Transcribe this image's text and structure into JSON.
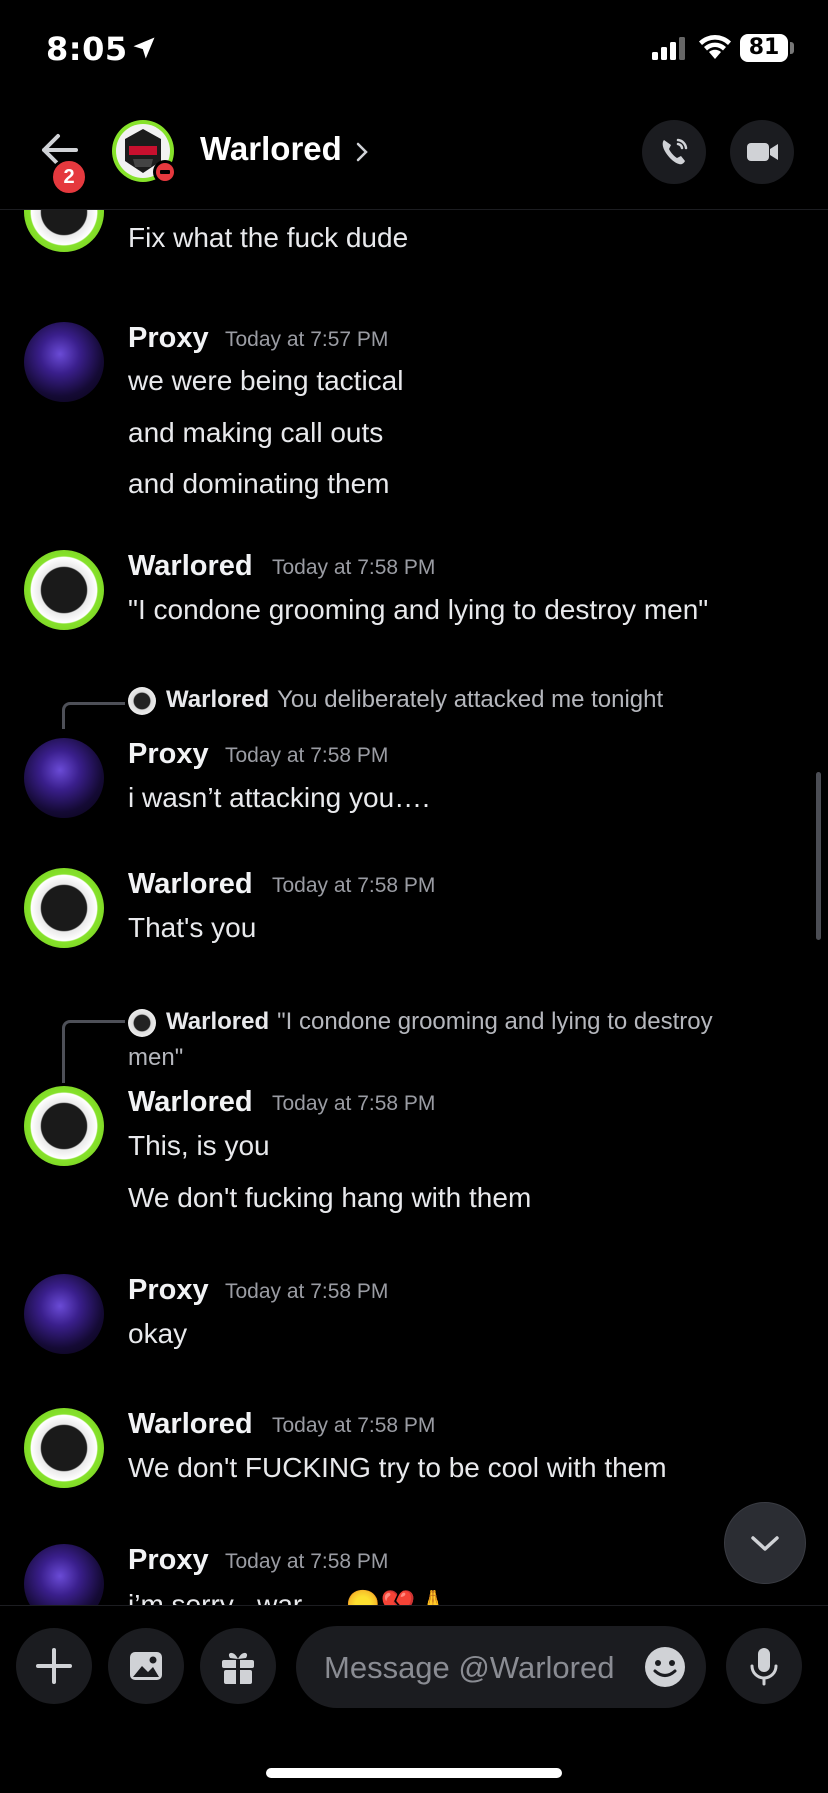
{
  "status_bar": {
    "time": "8:05",
    "battery": "81"
  },
  "header": {
    "back_badge": "2",
    "title": "Warlored",
    "chevron": "›"
  },
  "messages": [
    {
      "line": "Fix what the fuck dude"
    },
    {
      "author": "Proxy",
      "timestamp": "Today at 7:57 PM",
      "lines": [
        "we were being tactical",
        "and making call outs",
        "and dominating them"
      ]
    },
    {
      "author": "Warlored",
      "timestamp": "Today at 7:58 PM",
      "lines": [
        "\"I condone grooming and lying to destroy men\""
      ]
    },
    {
      "reply_to": {
        "author": "Warlored",
        "text": "You deliberately attacked me tonight"
      },
      "author": "Proxy",
      "timestamp": "Today at 7:58 PM",
      "lines": [
        "i wasn’t attacking you…."
      ]
    },
    {
      "author": "Warlored",
      "timestamp": "Today at 7:58 PM",
      "lines": [
        "That's you"
      ]
    },
    {
      "reply_to": {
        "author": "Warlored",
        "text": "\"I condone grooming and lying to destroy",
        "text2": "men\""
      },
      "author": "Warlored",
      "timestamp": "Today at 7:58 PM",
      "lines": [
        "This, is you",
        "We don't fucking hang with them"
      ]
    },
    {
      "author": "Proxy",
      "timestamp": "Today at 7:58 PM",
      "lines": [
        "okay"
      ]
    },
    {
      "author": "Warlored",
      "timestamp": "Today at 7:58 PM",
      "lines": [
        "We don't FUCKING try to be cool with them"
      ]
    },
    {
      "author": "Proxy",
      "timestamp": "Today at 7:58 PM",
      "lines": [
        "i’m sorry , war … 😞💔🙏"
      ]
    }
  ],
  "composer": {
    "placeholder": "Message @Warlored"
  },
  "colors": {
    "accent_green": "#86e22a",
    "badge_red": "#e5393e",
    "background": "#000000"
  }
}
